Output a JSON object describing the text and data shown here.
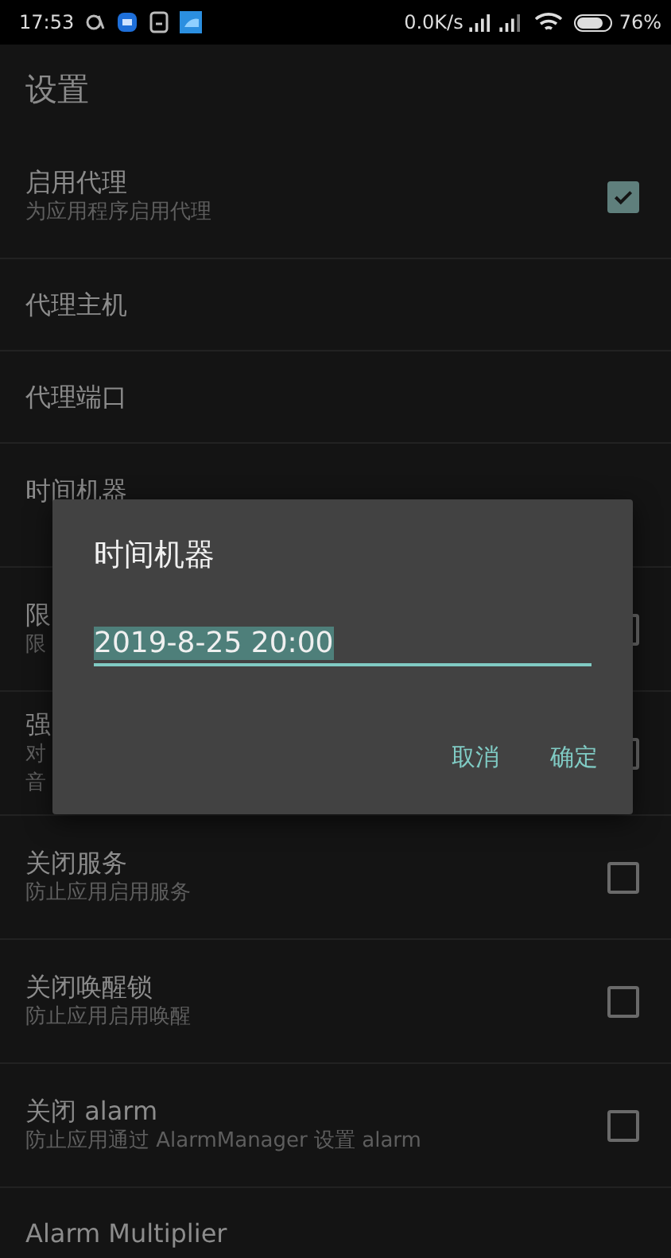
{
  "status_bar": {
    "time": "17:53",
    "net_speed": "0.0K/s",
    "battery": "76%"
  },
  "app_bar": {
    "title": "设置"
  },
  "settings": [
    {
      "title": "启用代理",
      "subtitle_lines": [
        "为应用程序启用代理"
      ],
      "kind": "checkbox",
      "checked": true
    },
    {
      "title": "代理主机",
      "kind": "text"
    },
    {
      "title": "代理端口",
      "kind": "text"
    },
    {
      "title": "时间机器",
      "kind": "text"
    },
    {
      "title": "限",
      "subtitle_lines": [
        "限"
      ],
      "kind": "checkbox",
      "checked": false
    },
    {
      "title": "强",
      "subtitle_lines": [
        "对",
        "音"
      ],
      "kind": "checkbox",
      "checked": false
    },
    {
      "title": "关闭服务",
      "subtitle_lines": [
        "防止应用启用服务"
      ],
      "kind": "checkbox",
      "checked": false
    },
    {
      "title": "关闭唤醒锁",
      "subtitle_lines": [
        "防止应用启用唤醒"
      ],
      "kind": "checkbox",
      "checked": false
    },
    {
      "title": "关闭 alarm",
      "subtitle_lines": [
        "防止应用通过 AlarmManager 设置 alarm"
      ],
      "kind": "checkbox",
      "checked": false
    },
    {
      "title": "Alarm Multiplier",
      "kind": "text"
    }
  ],
  "dialog": {
    "title": "时间机器",
    "value": "2019-8-25 20:00",
    "text_selected": true,
    "buttons": [
      "取消",
      "确定"
    ]
  }
}
